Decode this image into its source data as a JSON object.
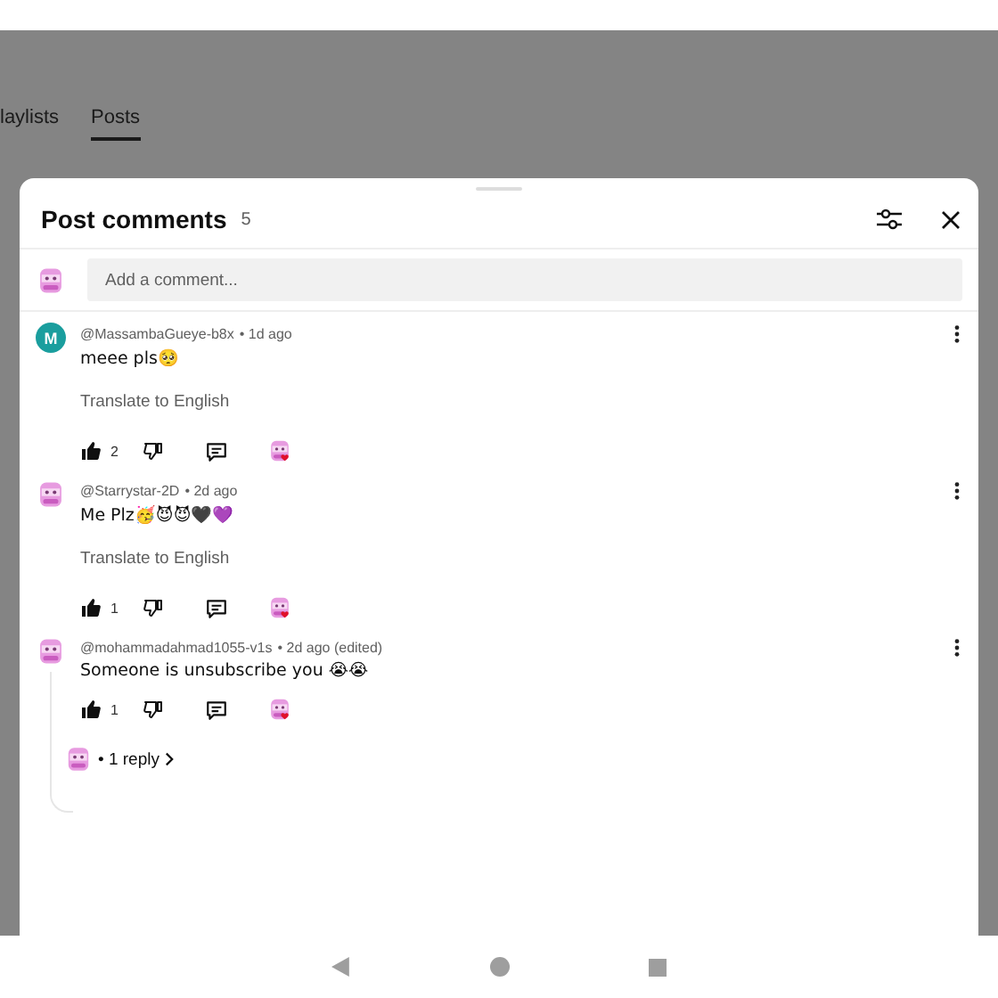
{
  "background": {
    "tabs": [
      {
        "label": "laylists",
        "selected": false
      },
      {
        "label": "Posts",
        "selected": true
      }
    ]
  },
  "sheet": {
    "title": "Post comments",
    "count": "5",
    "add_comment": {
      "placeholder": "Add a comment..."
    },
    "comments": [
      {
        "avatar": {
          "kind": "letter",
          "letter": "M",
          "color": "#1a9e9e"
        },
        "author": "@MassambaGueye-b8x",
        "time": "• 1d ago",
        "text": "meee pls🥺",
        "translate": "Translate to English",
        "likes": "2"
      },
      {
        "author": "@Starrystar-2D",
        "time": "• 2d ago",
        "text": "Me Plz🥳😈😈🖤💜",
        "translate": "Translate to English",
        "likes": "1"
      },
      {
        "author": "@mohammadahmad1055-v1s",
        "time": "• 2d ago (edited)",
        "text": "Someone is unsubscribe you 😭😭",
        "likes": "1",
        "replies": "• 1 reply"
      }
    ]
  }
}
